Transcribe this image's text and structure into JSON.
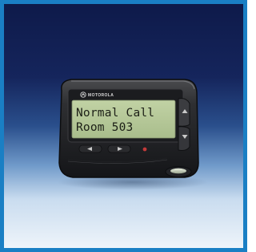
{
  "device": {
    "brand": "MOTOROLA",
    "display_lines": [
      "Normal Call",
      "Room 503"
    ]
  },
  "colors": {
    "border": "#1a7fc4",
    "lcd": "#b6c89a",
    "body": "#2a2b2d"
  },
  "icons": [
    "motorola-logo-icon",
    "arrow-up-icon",
    "arrow-down-icon",
    "arrow-left-icon",
    "arrow-right-icon",
    "red-dot-icon"
  ]
}
